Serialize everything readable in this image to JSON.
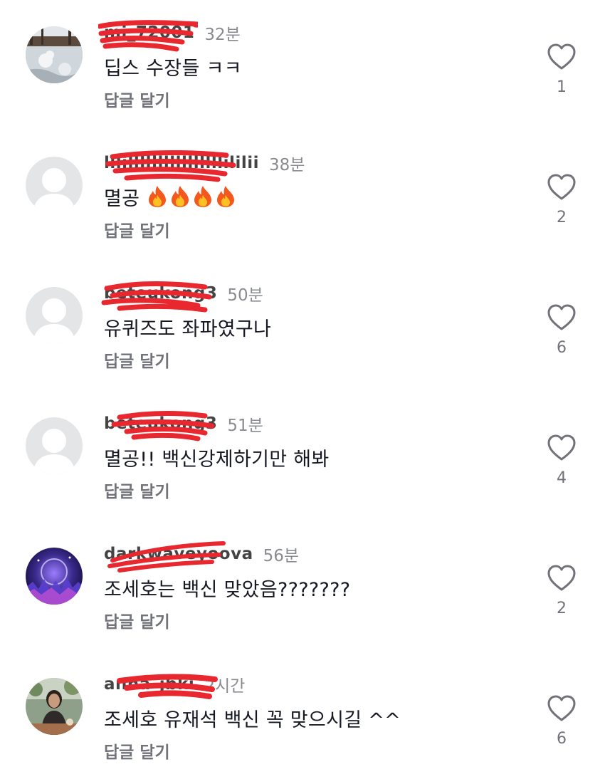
{
  "comments": [
    {
      "username": "mi_72001",
      "time": "32분",
      "text": "딥스 수장들 ㅋㅋ",
      "reply": "답글 달기",
      "likes": "1",
      "avatar": "snow-photo"
    },
    {
      "username": "lllillllllllllllllllililii",
      "time": "38분",
      "text": "멸공",
      "emoji": "🔥🔥🔥🔥",
      "reply": "답글 달기",
      "likes": "2",
      "avatar": "default"
    },
    {
      "username": "beteukong3",
      "time": "50분",
      "text": "유퀴즈도 좌파였구나",
      "reply": "답글 달기",
      "likes": "6",
      "avatar": "default"
    },
    {
      "username": "beteukong3",
      "time": "51분",
      "text": "멸공!! 백신강제하기만 해봐",
      "reply": "답글 달기",
      "likes": "4",
      "avatar": "default"
    },
    {
      "username": "darkwaveyoova",
      "time": "56분",
      "text": "조세호는 백신 맞았음???????",
      "reply": "답글 달기",
      "likes": "2",
      "avatar": "purple-art"
    },
    {
      "username": "anna_jbki",
      "time": "2시간",
      "text": "조세호 유재석 백신 꼭 맞으시길 ^^",
      "reply": "답글 달기",
      "likes": "6",
      "avatar": "woman-photo"
    }
  ],
  "colors": {
    "redaction": "#e8282e",
    "meta_gray": "#8a8b91",
    "icon_gray": "#72737a",
    "default_avatar_bg": "#e4e5e7"
  },
  "icons": {
    "like": "heart-outline-icon",
    "flame": "fire-emoji"
  }
}
